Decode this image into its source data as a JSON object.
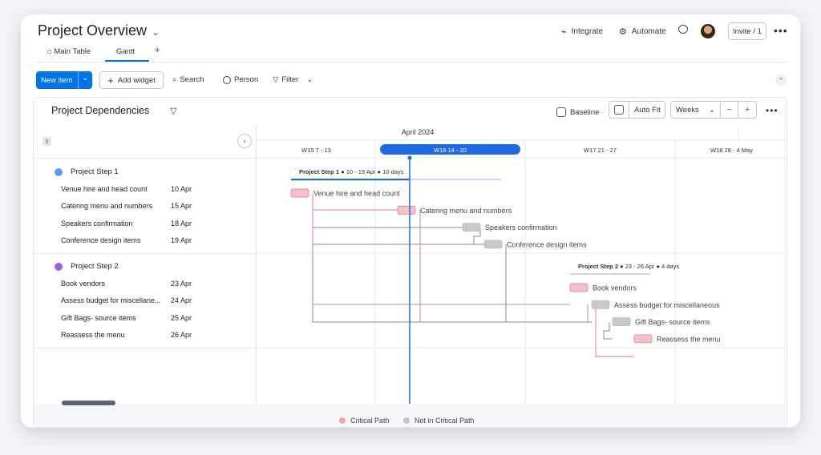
{
  "header": {
    "title": "Project Overview",
    "integrate": "Integrate",
    "automate": "Automate",
    "invite": "Invite / 1"
  },
  "tabs": [
    {
      "label": "Main Table"
    },
    {
      "label": "Gantt"
    },
    {
      "label": "+"
    }
  ],
  "toolbar": {
    "new_item": "New item",
    "add_widget": "Add widget",
    "search": "Search",
    "person": "Person",
    "filter": "Filter"
  },
  "panel": {
    "title": "Project Dependencies",
    "baseline": "Baseline",
    "auto_fit": "Auto Fit",
    "zoom": "Weeks",
    "zoom_minus": "−",
    "zoom_plus": "+"
  },
  "timeline": {
    "month": "April 2024",
    "weeks": [
      "W15 7 - 13",
      "W16 14 - 20",
      "W17 21 - 27",
      "W18 28 - 4 May"
    ],
    "current_week_index": 1
  },
  "groups": [
    {
      "name": "Project Step 1",
      "color": "#579bfc",
      "summary_dates": "10 - 19 Apr",
      "summary_duration": "10 days",
      "items": [
        {
          "name": "Venue hire and head count",
          "date": "10 Apr",
          "critical": true
        },
        {
          "name": "Catering menu and numbers",
          "date": "15 Apr",
          "critical": true
        },
        {
          "name": "Speakers confirmation",
          "date": "18 Apr",
          "critical": false
        },
        {
          "name": "Conference design items",
          "date": "19 Apr",
          "critical": false
        }
      ]
    },
    {
      "name": "Project Step 2",
      "color": "#a25ddc",
      "summary_dates": "23 - 26 Apr",
      "summary_duration": "4 days",
      "items": [
        {
          "name": "Book vendors",
          "date": "23 Apr",
          "critical": true
        },
        {
          "name": "Assess budget for miscellaneous",
          "display_name": "Assess budget for miscellane...",
          "date": "24 Apr",
          "critical": false
        },
        {
          "name": "Gift Bags- source items",
          "date": "25 Apr",
          "critical": false
        },
        {
          "name": "Reassess the menu",
          "date": "26 Apr",
          "critical": true
        }
      ]
    }
  ],
  "legend": {
    "critical": "Critical Path",
    "not_critical": "Not in Critical Path",
    "critical_color": "#f4a7b0",
    "not_critical_color": "#c4c4c4"
  },
  "colors": {
    "accent": "#0073ea",
    "today_line": "#1f6ae0",
    "critical_fill": "#f3c2c8",
    "critical_stroke": "#e27f8c",
    "neutral_fill": "#c9c9c9"
  }
}
